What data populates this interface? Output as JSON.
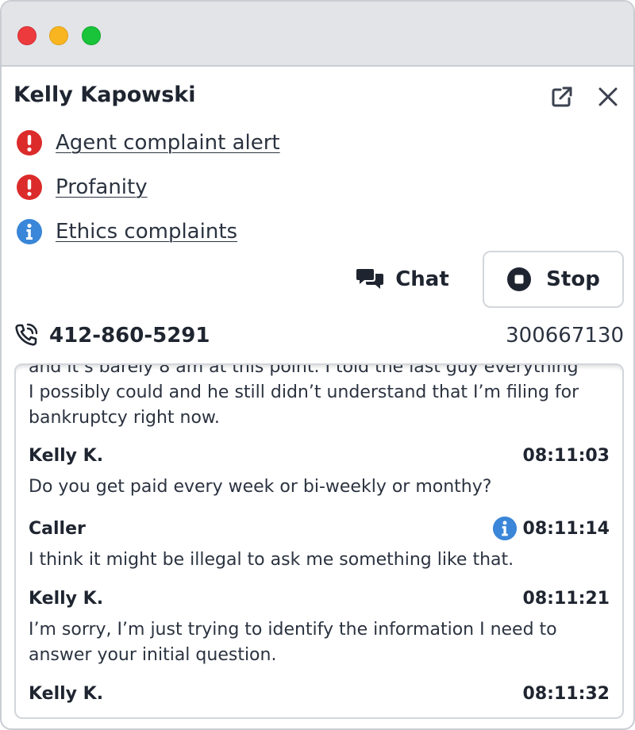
{
  "window": {
    "traffic_lights": [
      {
        "name": "close",
        "color": "#ed3a3d"
      },
      {
        "name": "minimize",
        "color": "#f8b51f"
      },
      {
        "name": "zoom",
        "color": "#19c43a"
      }
    ]
  },
  "header": {
    "contact_name": "Kelly Kapowski",
    "popout_icon": "external-link-icon",
    "close_icon": "close-icon"
  },
  "alerts": [
    {
      "label": "Agent complaint alert",
      "severity": "error",
      "icon": "exclamation-circle-icon",
      "color": "#dc2b2b"
    },
    {
      "label": "Profanity",
      "severity": "error",
      "icon": "exclamation-circle-icon",
      "color": "#dc2b2b"
    },
    {
      "label": "Ethics complaints",
      "severity": "info",
      "icon": "info-circle-icon",
      "color": "#3a86d8"
    }
  ],
  "actions": {
    "chat_label": "Chat",
    "chat_icon": "chat-bubbles-icon",
    "stop_label": "Stop",
    "stop_icon": "stop-circle-icon"
  },
  "call": {
    "phone_icon": "phone-ringing-icon",
    "phone_number": "412-860-5291",
    "call_id": "300667130"
  },
  "transcript": {
    "partial_text": "and it’s barely 8 am at this point. I told the last guy everything I possibly could and he still didn’t understand that I’m filing for bankruptcy right now.",
    "messages": [
      {
        "speaker": "Kelly K.",
        "time": "08:11:03",
        "text": "Do you get paid every week or bi-weekly or monthy?"
      },
      {
        "speaker": "Caller",
        "time": "08:11:14",
        "text": "I think it might be illegal to ask me something like that.",
        "flag_icon": "info-circle-icon"
      },
      {
        "speaker": "Kelly K.",
        "time": "08:11:21",
        "text": "I’m sorry, I’m just trying to identify the information I need to answer your initial question."
      },
      {
        "speaker": "Kelly K.",
        "time": "08:11:32",
        "text": ""
      }
    ]
  }
}
